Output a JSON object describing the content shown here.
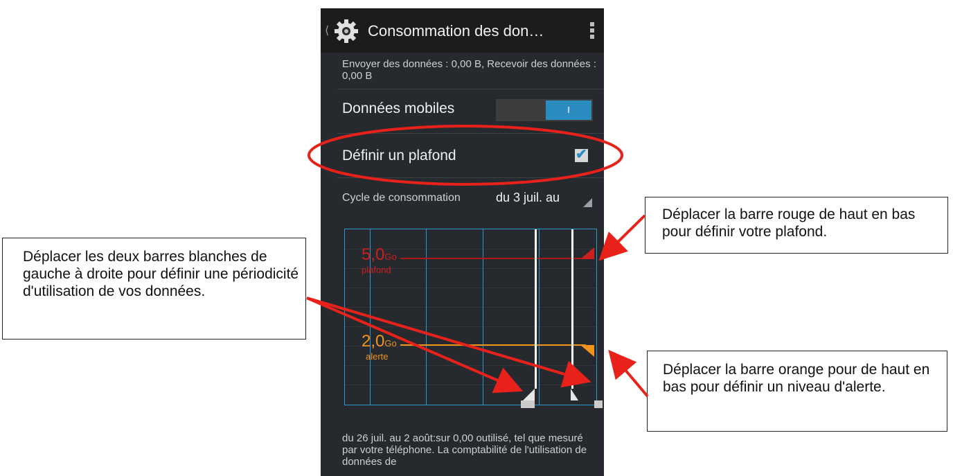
{
  "colors": {
    "accent": "#2a8cbf",
    "chart_grid": "#2d97d0",
    "limit_red": "#cc1f1f",
    "warning_orange": "#f2931c",
    "annotation_red": "#e8221b"
  },
  "header": {
    "back_icon": "chevron-left-icon",
    "settings_icon": "gear-icon",
    "title": "Consommation des don…",
    "menu_icon": "overflow-menu-icon"
  },
  "summary": {
    "send_receive": "Envoyer des données : 0,00 B, Recevoir des données : 0,00 B"
  },
  "mobile_data": {
    "label": "Données mobiles",
    "toggle_text": "I",
    "on": true
  },
  "limit": {
    "label": "Définir un plafond",
    "checked": true
  },
  "cycle": {
    "label": "Cycle de consommation",
    "value": "du 3 juil. au"
  },
  "chart": {
    "limit_value": "5,0",
    "limit_unit": "Go",
    "limit_label": "plafond",
    "warning_value": "2,0",
    "warning_unit": "Go",
    "warning_label": "alerte"
  },
  "usage_text": "du 26 juil. au 2 août:sur 0,00 outilisé, tel que mesuré par votre téléphone. La comptabilité de l'utilisation de données de",
  "annotations": {
    "left": "Déplacer les deux barres blanches de gauche à droite pour définir une périodicité d'utilisation de vos données.",
    "red": "Déplacer la barre rouge de haut en bas pour définir votre plafond.",
    "orange": "Déplacer la barre orange pour de haut en bas pour définir un niveau d'alerte."
  }
}
